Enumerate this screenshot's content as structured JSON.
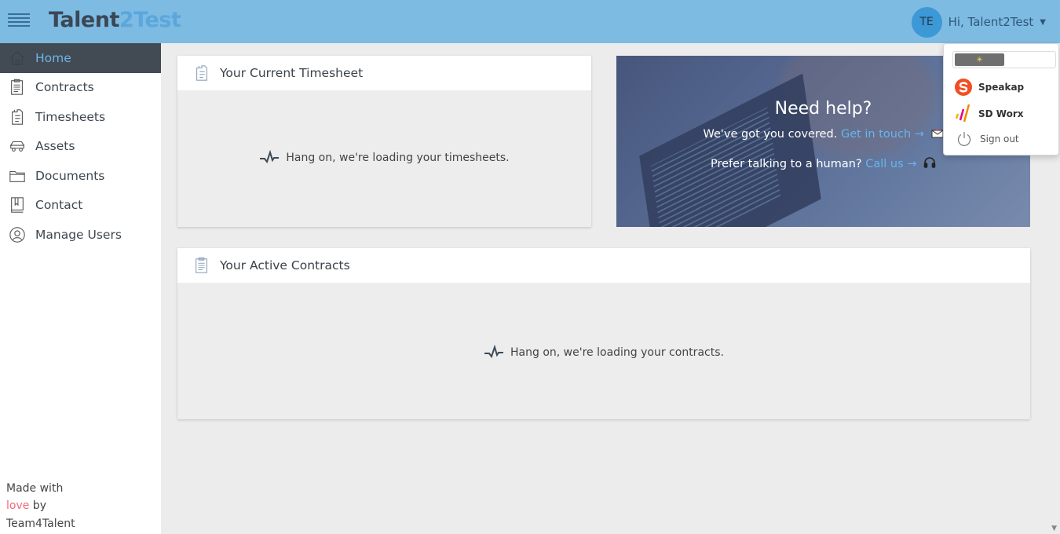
{
  "brand": {
    "part1": "Talent",
    "part2": "2Test"
  },
  "user": {
    "initials": "TE",
    "greeting": "Hi, Talent2Test"
  },
  "nav": [
    {
      "label": "Home",
      "icon": "home-icon",
      "active": true
    },
    {
      "label": "Contracts",
      "icon": "contract-icon"
    },
    {
      "label": "Timesheets",
      "icon": "timesheet-icon"
    },
    {
      "label": "Assets",
      "icon": "car-icon"
    },
    {
      "label": "Documents",
      "icon": "folder-icon"
    },
    {
      "label": "Contact",
      "icon": "contact-book-icon"
    },
    {
      "label": "Manage Users",
      "icon": "user-icon"
    }
  ],
  "footer": {
    "line1": "Made with",
    "love": "love",
    "by": " by",
    "line3": "Team4Talent"
  },
  "timesheet_card": {
    "title": "Your Current Timesheet",
    "loading": "Hang on, we're loading your timesheets."
  },
  "contracts_card": {
    "title": "Your Active Contracts",
    "loading": "Hang on, we're loading your contracts."
  },
  "help": {
    "title": "Need help?",
    "line1_text": "We've got you covered.",
    "line1_link": "Get in touch →",
    "line2_text": "Prefer talking to a human?",
    "line2_link": "Call us →"
  },
  "dropdown": {
    "items": [
      {
        "label": "Speakap",
        "icon": "speakap-logo-icon"
      },
      {
        "label": "SD Worx",
        "icon": "sdworx-logo-icon"
      }
    ],
    "signout": "Sign out"
  },
  "colors": {
    "topbar": "#7dbbe3",
    "accent": "#5ba7dc",
    "sidebar_active": "#424b54",
    "love": "#f06a7a"
  }
}
